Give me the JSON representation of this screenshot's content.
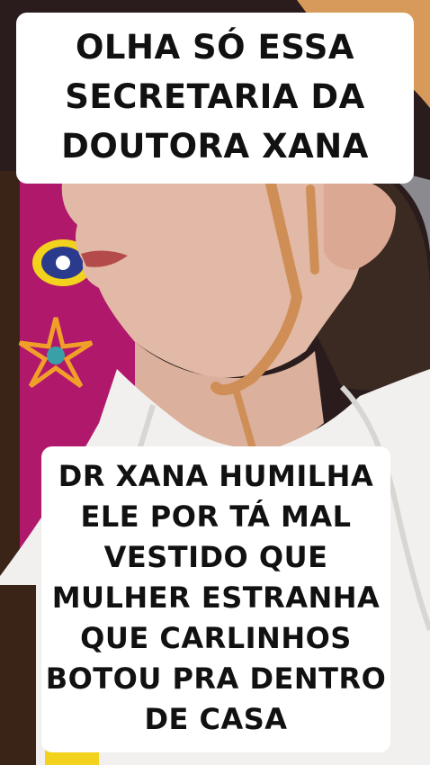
{
  "captions": {
    "top": {
      "lines": [
        "OLHA SÓ ESSA",
        "SECRETARIA DA",
        "DOUTORA XANA"
      ]
    },
    "bottom": {
      "lines": [
        "DR XANA HUMILHA",
        "ELE POR TÁ MAL",
        "VESTIDO QUE",
        "MULHER ESTRANHA",
        "QUE CARLINHOS",
        "BOTOU PRA DENTRO",
        "DE CASA"
      ]
    }
  },
  "colors": {
    "caption_bg": "#ffffff",
    "caption_text": "#111111",
    "skin": "#e2b9a6",
    "hair": "#3b2a22",
    "cord": "#cf8e55",
    "shirt": "#f1f0ee",
    "backdrop": "#b0186c"
  }
}
